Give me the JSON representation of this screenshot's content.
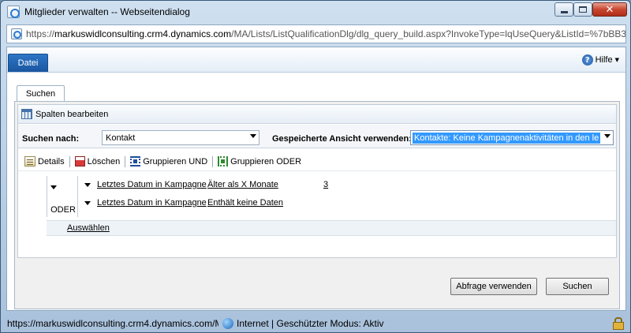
{
  "window": {
    "title": "Mitglieder verwalten -- Webseitendialog"
  },
  "address": {
    "prefix": "https://",
    "domain": "markuswidlconsulting.crm4.dynamics.com",
    "path": "/MA/Lists/ListQualificationDlg/dlg_query_build.aspx?InvokeType=lqUseQuery&ListId=%7bBB3E"
  },
  "ribbon": {
    "file_tab": "Datei",
    "help_label": "Hilfe"
  },
  "tabs": {
    "search_tab": "Suchen"
  },
  "query": {
    "edit_columns": "Spalten bearbeiten",
    "search_for_label": "Suchen nach:",
    "search_for_value": "Kontakt",
    "saved_view_label": "Gespeicherte Ansicht verwenden:",
    "saved_view_value": "Kontakte: Keine Kampagnenaktivitäten in den le",
    "toolbar": {
      "details": "Details",
      "delete": "Löschen",
      "group_and": "Gruppieren UND",
      "group_or": "Gruppieren ODER"
    },
    "group_operator": "ODER",
    "conditions": [
      {
        "field": "Letztes Datum in Kampagne",
        "operator": "Älter als X Monate",
        "value": "3"
      },
      {
        "field": "Letztes Datum in Kampagne",
        "operator": "Enthält keine Daten",
        "value": ""
      }
    ],
    "select_link": "Auswählen"
  },
  "buttons": {
    "use_query": "Abfrage verwenden",
    "search": "Suchen"
  },
  "statusbar": {
    "url": "https://markuswidlconsulting.crm4.dynamics.com/M",
    "zone": "Internet | Geschützter Modus: Aktiv"
  }
}
